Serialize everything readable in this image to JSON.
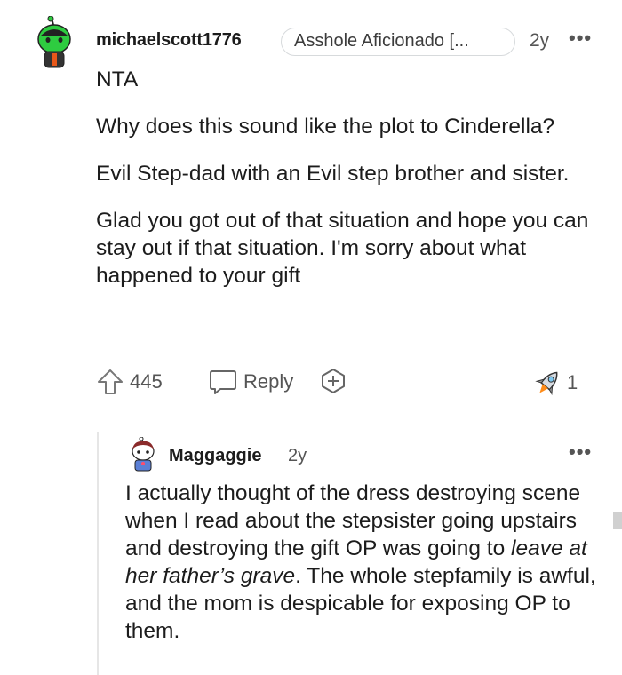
{
  "comment": {
    "username": "michaelscott1776",
    "flair": "Asshole Aficionado [...",
    "age": "2y",
    "more": "•••",
    "paragraphs": [
      "NTA",
      "Why does this sound like the plot to Cinderella?",
      "Evil Step-dad with an Evil step brother and sister.",
      "Glad you got out of that situation and hope you can stay out if that situation. I'm sorry about what happened to your gift"
    ],
    "upvotes": "445",
    "reply_label": "Reply",
    "award_count": "1",
    "icons": [
      "upvote-arrow-icon",
      "reply-bubble-icon",
      "award-plus-icon",
      "rocket-award-icon",
      "more-options-icon"
    ]
  },
  "reply": {
    "username": "Maggaggie",
    "age": "2y",
    "more": "•••",
    "text_before": "I actually thought of the dress destroying scene when I read about the stepsister going upstairs and destroying the gift OP was going to ",
    "text_italic": "leave at her father’s grave",
    "text_after": ". The whole stepfamily is awful, and the mom is despicable for exposing OP to them."
  },
  "colors": {
    "avatar_green": "#2ecc40",
    "text": "#1c1c1c",
    "meta": "#555555",
    "border": "#d7dadc"
  }
}
